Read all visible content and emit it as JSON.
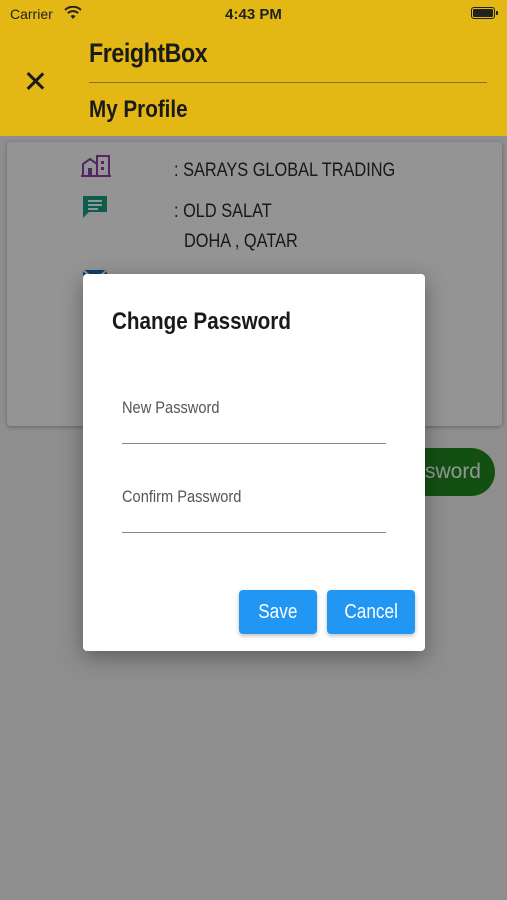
{
  "status_bar": {
    "carrier": "Carrier",
    "time": "4:43 PM"
  },
  "header": {
    "app_title": "FreightBox",
    "page_title": "My Profile"
  },
  "profile": {
    "company": ": SARAYS GLOBAL TRADING",
    "address_line1": ": OLD SALAT",
    "address_line2": "DOHA , QATAR",
    "email_partial": "",
    "change_password_button": "ssword"
  },
  "colors": {
    "header_bg": "#e3b814",
    "icon_purple": "#8e44ad",
    "icon_teal": "#16a085",
    "icon_blue": "#1e6fb8",
    "button_green": "#1f8a1f",
    "dialog_button": "#2196f3"
  },
  "icons": {
    "close": "close-icon",
    "company": "building-icon",
    "address": "message-icon",
    "email": "mail-icon",
    "wifi": "wifi-icon",
    "battery": "battery-icon"
  },
  "dialog": {
    "title": "Change Password",
    "new_password_label": "New Password",
    "confirm_password_label": "Confirm Password",
    "new_password_value": "",
    "confirm_password_value": "",
    "save_label": "Save",
    "cancel_label": "Cancel"
  }
}
